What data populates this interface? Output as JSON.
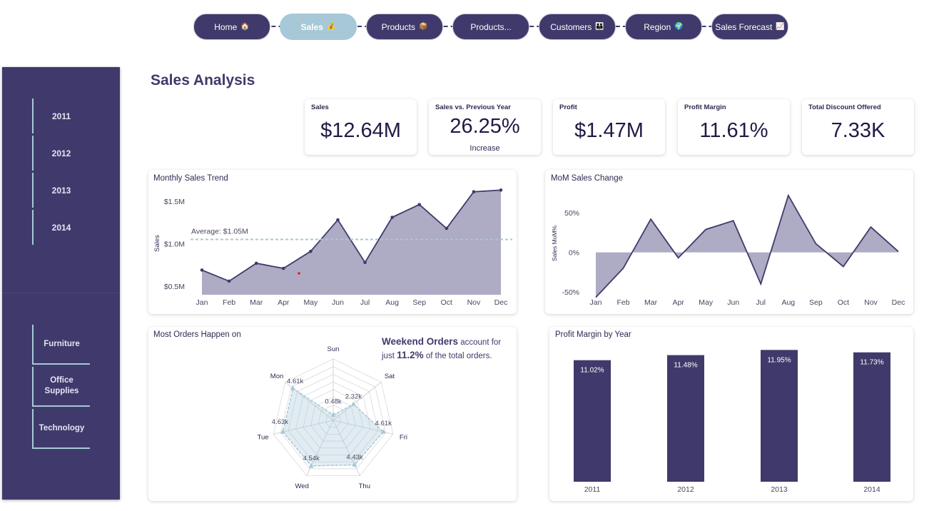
{
  "nav": {
    "items": [
      {
        "label": "Home",
        "emoji": "🏠",
        "active": false
      },
      {
        "label": "Sales",
        "emoji": "💰",
        "active": true
      },
      {
        "label": "Products",
        "emoji": "📦",
        "active": false
      },
      {
        "label": "Products...",
        "emoji": "",
        "active": false
      },
      {
        "label": "Customers",
        "emoji": "👪",
        "active": false
      },
      {
        "label": "Region",
        "emoji": "🌍",
        "active": false
      },
      {
        "label": "Sales Forecast",
        "emoji": "📈",
        "active": false
      }
    ]
  },
  "sidebar": {
    "years": [
      "2011",
      "2012",
      "2013",
      "2014"
    ],
    "categories": [
      "Furniture",
      "Office Supplies",
      "Technology"
    ]
  },
  "page_title": "Sales Analysis",
  "kpis": [
    {
      "label": "Sales",
      "value": "$12.64M",
      "sub": ""
    },
    {
      "label": "Sales vs. Previous Year",
      "value": "26.25%",
      "sub": "Increase"
    },
    {
      "label": "Profit",
      "value": "$1.47M",
      "sub": ""
    },
    {
      "label": "Profit Margin",
      "value": "11.61%",
      "sub": ""
    },
    {
      "label": "Total Discount Offered",
      "value": "7.33K",
      "sub": ""
    }
  ],
  "radar_note": {
    "bold": "Weekend Orders",
    "text1": " account for just ",
    "pct": "11.2%",
    "text2": " of the total orders."
  },
  "colors": {
    "primary": "#3f3a6b",
    "accent": "#a7c8d6",
    "area": "#aeabc4"
  },
  "chart_data": [
    {
      "type": "area",
      "title": "Monthly Sales Trend",
      "xlabel": "",
      "ylabel": "Sales",
      "categories": [
        "Jan",
        "Feb",
        "Mar",
        "Apr",
        "May",
        "Jun",
        "Jul",
        "Aug",
        "Sep",
        "Oct",
        "Nov",
        "Dec"
      ],
      "values": [
        0.69,
        0.56,
        0.77,
        0.71,
        0.91,
        1.28,
        0.78,
        1.31,
        1.46,
        1.18,
        1.61,
        1.63
      ],
      "ylim": [
        0.4,
        1.7
      ],
      "yticks": [
        0.5,
        1.0,
        1.5
      ],
      "ytick_labels": [
        "$0.5M",
        "$1.0M",
        "$1.5M"
      ],
      "average": 1.05,
      "average_label": "Average: $1.05M"
    },
    {
      "type": "area",
      "title": "MoM Sales Change",
      "xlabel": "",
      "ylabel": "Sales MoM%",
      "categories": [
        "Jan",
        "Feb",
        "Mar",
        "Apr",
        "May",
        "Jun",
        "Jul",
        "Aug",
        "Sep",
        "Oct",
        "Nov",
        "Dec"
      ],
      "values": [
        -57,
        -20,
        42,
        -7,
        29,
        40,
        -40,
        72,
        11,
        -18,
        32,
        1
      ],
      "ylim": [
        -60,
        80
      ],
      "yticks": [
        -50,
        0,
        50
      ],
      "ytick_labels": [
        "-50%",
        "0%",
        "50%"
      ]
    },
    {
      "type": "radar",
      "title": "Most Orders Happen on",
      "axes": [
        "Sun",
        "Sat",
        "Fri",
        "Thu",
        "Wed",
        "Tue",
        "Mon"
      ],
      "values": [
        0.48,
        2.32,
        4.61,
        4.43,
        4.54,
        4.63,
        4.61
      ],
      "value_labels": [
        "0.48k",
        "2.32k",
        "4.61k",
        "4.43k",
        "4.54k",
        "4.63k",
        "4.61k"
      ],
      "max": 5.5
    },
    {
      "type": "bar",
      "title": "Profit Margin by Year",
      "categories": [
        "2011",
        "2012",
        "2013",
        "2014"
      ],
      "values": [
        11.02,
        11.48,
        11.95,
        11.73
      ],
      "value_labels": [
        "11.02%",
        "11.48%",
        "11.95%",
        "11.73%"
      ],
      "ylim": [
        0,
        12.1
      ]
    }
  ]
}
